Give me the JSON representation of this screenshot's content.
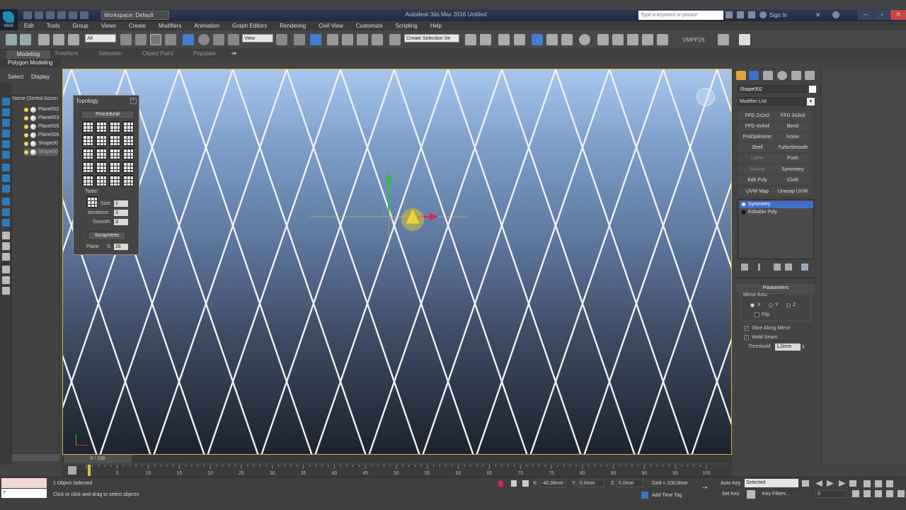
{
  "app": {
    "logo_text": "MAX",
    "window_title": "Autodesk 3ds Max 2016     Untitled",
    "workspace": "Workspace: Default",
    "search_placeholder": "Type a keyword or phrase",
    "sign_in": "Sign In"
  },
  "menu": [
    "Edit",
    "Tools",
    "Group",
    "Views",
    "Create",
    "Modifiers",
    "Animation",
    "Graph Editors",
    "Rendering",
    "Civil View",
    "Customize",
    "Scripting",
    "Help"
  ],
  "toolbar": {
    "selection_filter": "All",
    "ref_coord": "View",
    "named_selection": "Create Selection Se",
    "vmpp_label": "VMPP26"
  },
  "ribbon": {
    "tabs": [
      "Modeling",
      "Freeform",
      "Selection",
      "Object Paint",
      "Populate"
    ],
    "sub_label": "Polygon Modeling"
  },
  "scene_explorer": {
    "tabs": [
      "Select",
      "Display"
    ],
    "header": "Name (Sorted Ascen",
    "items": [
      {
        "name": "Plane002",
        "selected": false
      },
      {
        "name": "Plane003",
        "selected": false
      },
      {
        "name": "Plane005",
        "selected": false
      },
      {
        "name": "Plane006",
        "selected": false
      },
      {
        "name": "Shape00",
        "selected": false
      },
      {
        "name": "Shape00",
        "selected": true
      }
    ]
  },
  "topology": {
    "title": "Topology",
    "procedural_label": "Procedural",
    "tatter_label": "Tatter:",
    "size_label": "Size:",
    "size_value": "1",
    "iterations_label": "Iterations:",
    "iterations_value": "3",
    "smooth_label": "Smooth:",
    "smooth_value": "3",
    "scrapverts_label": "ScrapVerts",
    "plane_label": "Plane",
    "s_label": "S:",
    "s_value": "26"
  },
  "command_panel": {
    "object_name": "Shape002",
    "modifier_list_label": "Modifier List",
    "modifier_buttons": [
      {
        "label": "FFD 2x2x2",
        "dim": false
      },
      {
        "label": "FFD 3x3x3",
        "dim": false
      },
      {
        "label": "FFD 4x4x4",
        "dim": false
      },
      {
        "label": "Bend",
        "dim": false
      },
      {
        "label": "ProOptimizer",
        "dim": false
      },
      {
        "label": "Noise",
        "dim": false
      },
      {
        "label": "Shell",
        "dim": false
      },
      {
        "label": "TurboSmooth",
        "dim": false
      },
      {
        "label": "Lathe",
        "dim": true
      },
      {
        "label": "Push",
        "dim": false
      },
      {
        "label": "Sweep",
        "dim": true
      },
      {
        "label": "Symmetry",
        "dim": false
      },
      {
        "label": "Edit Poly",
        "dim": false
      },
      {
        "label": "Cloth",
        "dim": false
      },
      {
        "label": "UVW Map",
        "dim": false
      },
      {
        "label": "Unwrap UVW",
        "dim": false
      }
    ],
    "stack": [
      {
        "label": "Symmetry",
        "selected": true
      },
      {
        "label": "Editable Poly",
        "selected": false
      }
    ],
    "parameters_title": "Parameters",
    "mirror_axis_label": "Mirror Axis:",
    "axes": [
      "X",
      "Y",
      "Z"
    ],
    "selected_axis": "X",
    "flip_label": "Flip",
    "slice_label": "Slice Along Mirror",
    "weld_label": "Weld Seam",
    "threshold_label": "Threshold:",
    "threshold_value": "1,0mm"
  },
  "timeline": {
    "frame_label": "0 / 100",
    "ticks": [
      "0",
      "5",
      "10",
      "15",
      "20",
      "25",
      "30",
      "35",
      "40",
      "45",
      "50",
      "55",
      "60",
      "65",
      "70",
      "75",
      "80",
      "85",
      "90",
      "95",
      "100"
    ]
  },
  "status": {
    "selected_text": "1 Object Selected",
    "prompt_text": "Click or click-and-drag to select objects",
    "maxscript_value": "?",
    "x_label": "X:",
    "x_value": "-40,38mm",
    "y_label": "Y:",
    "y_value": "0,0mm",
    "z_label": "Z:",
    "z_value": "0,0mm",
    "grid_text": "Grid = 100,0mm",
    "add_time_tag": "Add Time Tag",
    "auto_key": "Auto Key",
    "set_key": "Set Key",
    "key_mode": "Selected",
    "key_filters": "Key Filters...",
    "frame_value": "0"
  },
  "colors": {
    "accent_blue": "#3e70c8",
    "viewport_border": "#d6b03a",
    "gizmo_x": "#e0224e",
    "gizmo_y": "#2fbf3c"
  }
}
